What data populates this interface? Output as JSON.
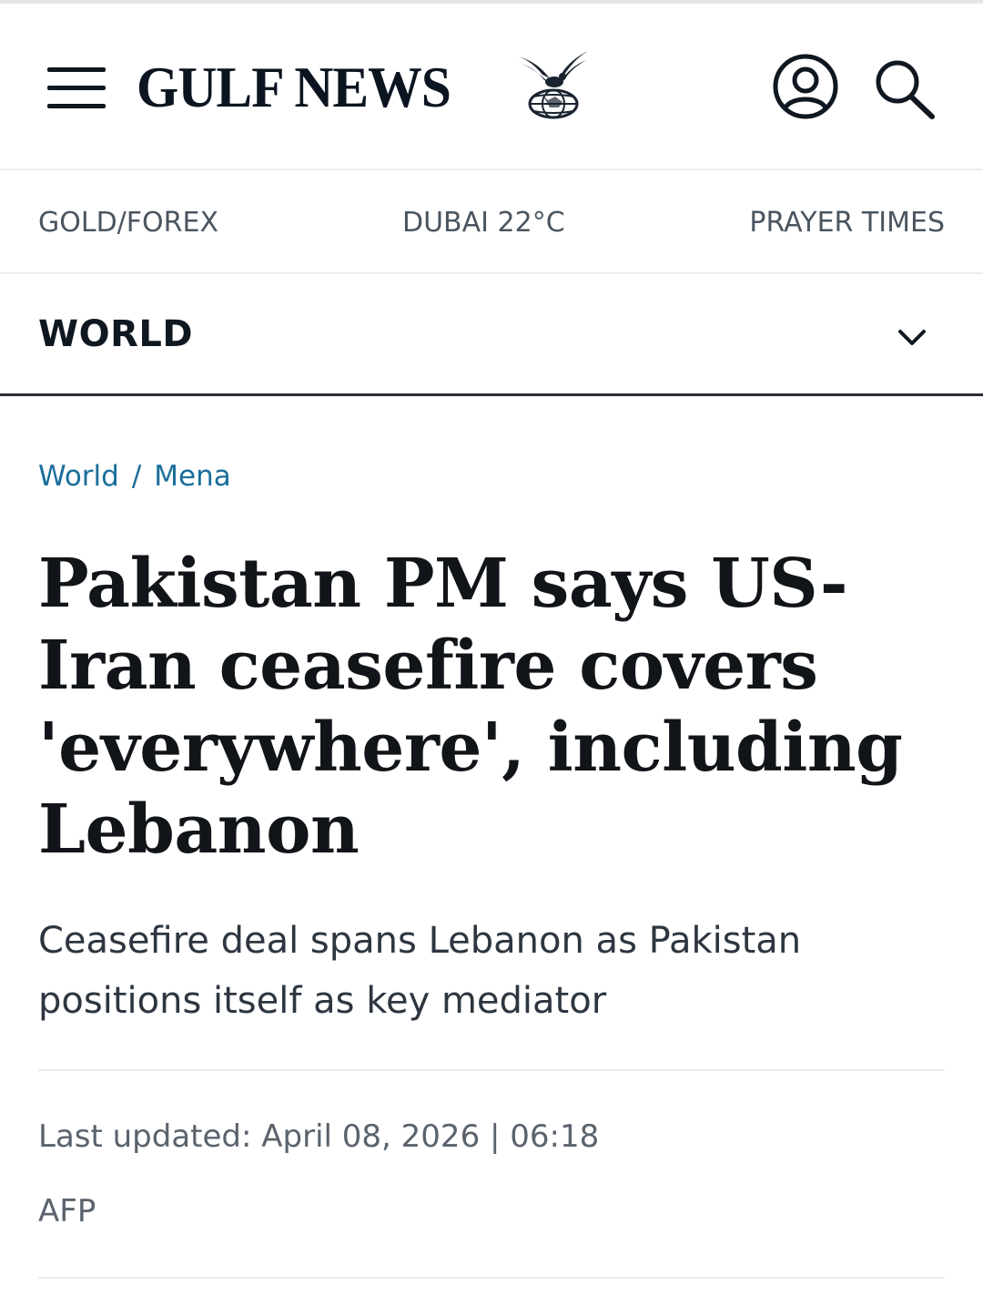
{
  "header": {
    "brand_name": "GULF NEWS",
    "menu_icon": "hamburger-menu-icon",
    "logo_icon": "falcon-globe-logo-icon",
    "account_icon": "user-account-icon",
    "search_icon": "search-icon"
  },
  "quick_links": [
    {
      "label": "GOLD/FOREX"
    },
    {
      "label": "DUBAI 22°C"
    },
    {
      "label": "PRAYER TIMES"
    }
  ],
  "section": {
    "title": "WORLD",
    "expand_icon": "chevron-down-icon"
  },
  "breadcrumb": {
    "items": [
      "World",
      "Mena"
    ],
    "separator": "/"
  },
  "article": {
    "headline": "Pakistan PM says US-Iran ceasefire covers 'everywhere', including Lebanon",
    "subheadline": "Ceasefire deal spans Lebanon as Pakistan positions itself as key mediator",
    "last_updated": "Last updated: April 08, 2026 | 06:18",
    "byline": "AFP"
  },
  "colors": {
    "brand_navy": "#0b1420",
    "link_blue": "#1a6e9b",
    "muted_text": "#5a636d"
  }
}
